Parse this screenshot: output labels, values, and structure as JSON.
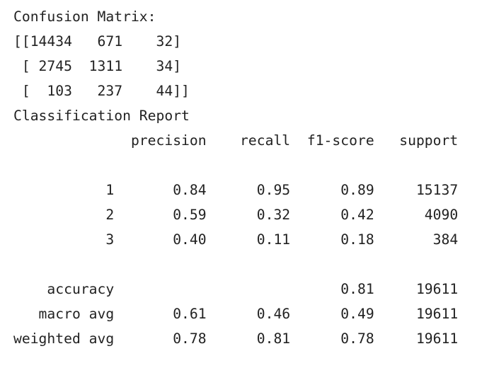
{
  "output": {
    "lines": [
      "Confusion Matrix:",
      "[[14434   671    32]",
      " [ 2745  1311    34]",
      " [  103   237    44]]",
      "Classification Report",
      "              precision    recall  f1-score   support",
      "",
      "           1       0.84      0.95      0.89     15137",
      "           2       0.59      0.32      0.42      4090",
      "           3       0.40      0.11      0.18       384",
      "",
      "    accuracy                           0.81     19611",
      "   macro avg       0.61      0.46      0.49     19611",
      "weighted avg       0.78      0.81      0.78     19611"
    ]
  }
}
